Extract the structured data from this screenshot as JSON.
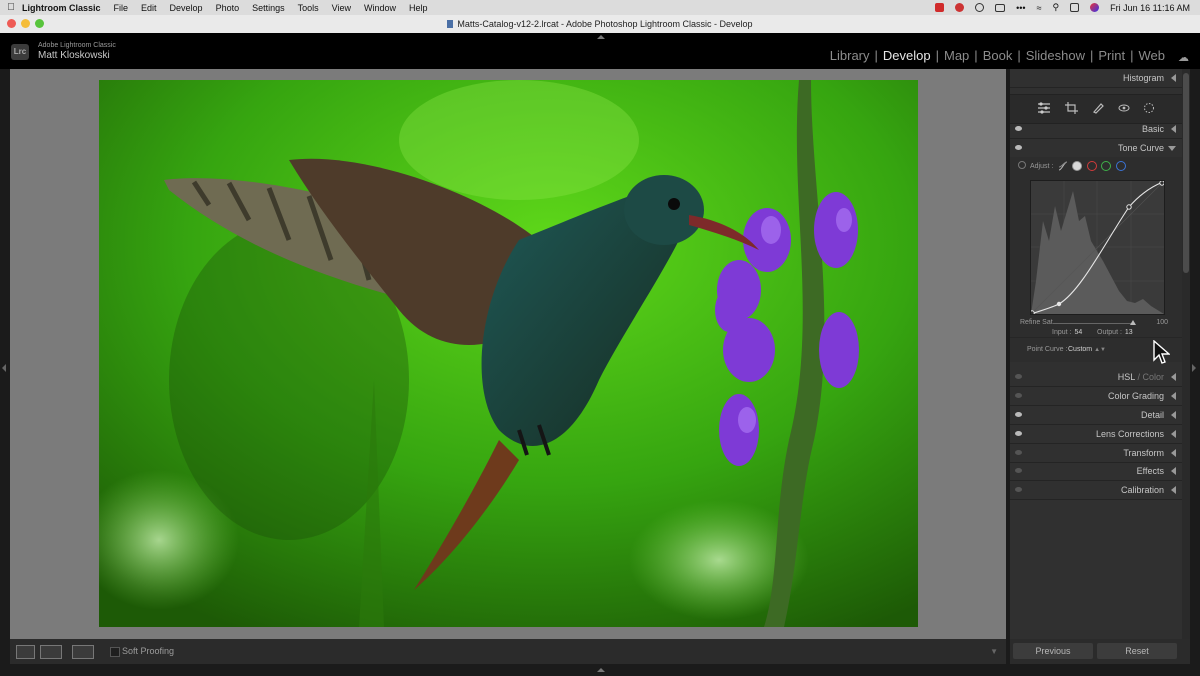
{
  "menubar": {
    "app": "Lightroom Classic",
    "items": [
      "File",
      "Edit",
      "Develop",
      "Photo",
      "Settings",
      "Tools",
      "View",
      "Window",
      "Help"
    ],
    "clock": "Fri Jun 16  11:16 AM"
  },
  "window": {
    "title": "Matts-Catalog-v12-2.lrcat - Adobe Photoshop Lightroom Classic - Develop"
  },
  "identity": {
    "badge": "Lrc",
    "product": "Adobe Lightroom Classic",
    "user": "Matt Kloskowski"
  },
  "modules": [
    "Library",
    "Develop",
    "Map",
    "Book",
    "Slideshow",
    "Print",
    "Web"
  ],
  "active_module": "Develop",
  "toolbar": {
    "soft_proofing": "Soft Proofing"
  },
  "panels": {
    "histogram": "Histogram",
    "basic": "Basic",
    "tone_curve": "Tone Curve",
    "hsl_a": "HSL",
    "hsl_sep": " / ",
    "hsl_b": "Color",
    "color_grading": "Color Grading",
    "detail": "Detail",
    "lens_corrections": "Lens Corrections",
    "transform": "Transform",
    "effects": "Effects",
    "calibration": "Calibration"
  },
  "tone_curve": {
    "adjust_label": "Adjust :",
    "refine_label": "Refine Sat.",
    "refine_max": "100",
    "input_label": "Input :",
    "input_value": "54",
    "output_label": "Output :",
    "output_value": "13",
    "point_curve_label": "Point Curve :",
    "point_curve_value": "Custom",
    "channel_colors": [
      "#cfcfcf",
      "#d23b3b",
      "#3fb04a",
      "#3b74d6"
    ]
  },
  "buttons": {
    "previous": "Previous",
    "reset": "Reset"
  },
  "icons": [
    "apple-icon",
    "lrc-logo-icon",
    "cloud-icon",
    "edit-sliders-icon",
    "crop-icon",
    "healing-icon",
    "redeye-icon",
    "masking-icon",
    "eye-icon",
    "cursor-arrow-icon"
  ]
}
